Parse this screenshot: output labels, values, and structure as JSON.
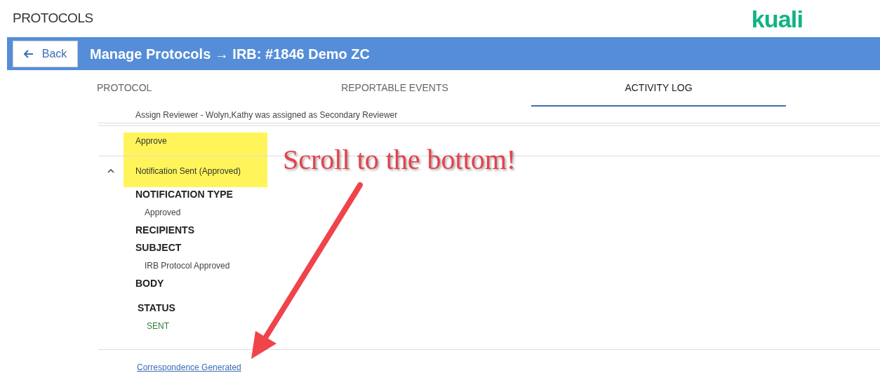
{
  "header": {
    "title": "PROTOCOLS",
    "logo": "kuali"
  },
  "bar": {
    "back_label": "Back",
    "title": "Manage Protocols → IRB: #1846 Demo ZC"
  },
  "tabs": [
    {
      "label": "PROTOCOL",
      "selected": false
    },
    {
      "label": "REPORTABLE EVENTS",
      "selected": false
    },
    {
      "label": "ACTIVITY LOG",
      "selected": true
    }
  ],
  "log": {
    "previous_entry": "Assign Reviewer - Wolyn,Kathy was assigned as Secondary Reviewer",
    "entries": [
      {
        "title": "Approve",
        "expanded": false
      },
      {
        "title": "Notification Sent (Approved)",
        "expanded": true,
        "details": [
          {
            "label": "NOTIFICATION TYPE",
            "value": "Approved"
          },
          {
            "label": "RECIPIENTS"
          },
          {
            "label": "SUBJECT",
            "value": "IRB Protocol Approved"
          },
          {
            "label": "BODY"
          },
          {
            "label": "STATUS",
            "value": "SENT",
            "kind": "status"
          }
        ]
      }
    ],
    "link": "Correspondence Generated"
  },
  "annotation": {
    "text": "Scroll to the bottom!"
  }
}
